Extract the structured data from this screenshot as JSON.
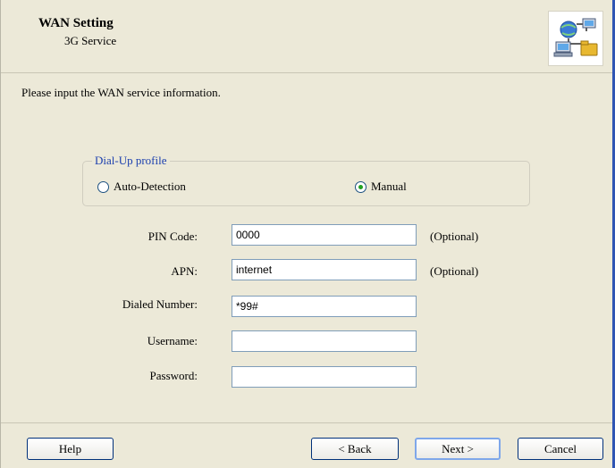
{
  "header": {
    "title": "WAN Setting",
    "subtitle": "3G Service",
    "icon": "network-wizard-icon"
  },
  "instruction": "Please input the WAN service information.",
  "dialup": {
    "legend": "Dial-Up profile",
    "options": [
      {
        "label": "Auto-Detection",
        "selected": false
      },
      {
        "label": "Manual",
        "selected": true
      }
    ]
  },
  "fields": {
    "pin": {
      "label": "PIN Code:",
      "value": "0000",
      "note": "(Optional)"
    },
    "apn": {
      "label": "APN:",
      "value": "internet",
      "note": "(Optional)"
    },
    "dialed": {
      "label": "Dialed Number:",
      "value": "*99#"
    },
    "username": {
      "label": "Username:",
      "value": ""
    },
    "password": {
      "label": "Password:",
      "value": ""
    }
  },
  "buttons": {
    "help": "Help",
    "back": "< Back",
    "next": "Next >",
    "cancel": "Cancel"
  },
  "colors": {
    "background": "#ece9d8",
    "legend": "#1b3fae",
    "window_edge": "#2f55b4"
  }
}
